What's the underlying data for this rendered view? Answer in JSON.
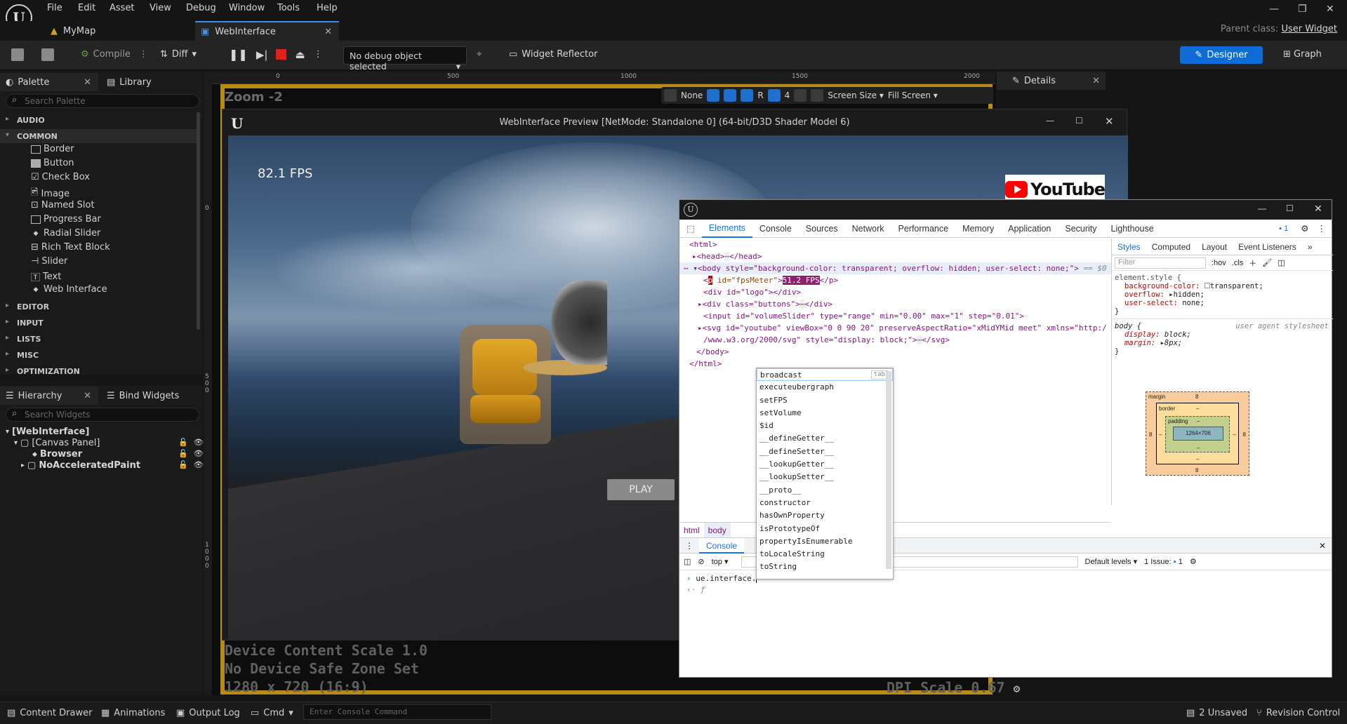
{
  "menu": {
    "items": [
      "File",
      "Edit",
      "Asset",
      "View",
      "Debug",
      "Window",
      "Tools",
      "Help"
    ]
  },
  "tabs": {
    "map": "MyMap",
    "widget": "WebInterface",
    "parent_class_label": "Parent class:",
    "parent_class_value": "User Widget"
  },
  "toolbar": {
    "compile": "Compile",
    "diff": "Diff",
    "debug_select": "No debug object selected",
    "widget_reflector": "Widget Reflector",
    "designer": "Designer",
    "graph": "Graph"
  },
  "palette": {
    "tab": "Palette",
    "library_tab": "Library",
    "search_placeholder": "Search Palette",
    "categories": [
      "AUDIO",
      "COMMON",
      "EDITOR",
      "INPUT",
      "LISTS",
      "MISC",
      "OPTIMIZATION"
    ],
    "common_items": [
      "Border",
      "Button",
      "Check Box",
      "Image",
      "Named Slot",
      "Progress Bar",
      "Radial Slider",
      "Rich Text Block",
      "Slider",
      "Text",
      "Web Interface"
    ]
  },
  "hierarchy": {
    "tab": "Hierarchy",
    "bind_tab": "Bind Widgets",
    "search_placeholder": "Search Widgets",
    "items": [
      "[WebInterface]",
      "[Canvas Panel]",
      "Browser",
      "NoAcceleratedPaint"
    ]
  },
  "canvas": {
    "zoom": "Zoom -2",
    "ruler_marks": [
      "0",
      "500",
      "1000",
      "1500",
      "2000"
    ],
    "ruler_left": [
      "0",
      "500",
      "1000"
    ],
    "none_label": "None",
    "r_label": "R",
    "grid_value": "4",
    "screen_size": "Screen Size",
    "fill_screen": "Fill Screen",
    "device_scale": "Device Content Scale 1.0",
    "safe_zone": "No Device Safe Zone Set",
    "resolution": "1280 x 720 (16:9)",
    "dpi_scale": "DPI Scale 0.67"
  },
  "preview": {
    "title": "WebInterface Preview [NetMode: Standalone 0]  (64-bit/D3D Shader Model 6)",
    "fps": "82.1 FPS",
    "youtube": "YouTube",
    "play": "PLAY"
  },
  "devtools": {
    "tabs": [
      "Elements",
      "Console",
      "Sources",
      "Network",
      "Performance",
      "Memory",
      "Application",
      "Security",
      "Lighthouse"
    ],
    "issues_count": "1",
    "styles_tabs": [
      "Styles",
      "Computed",
      "Layout",
      "Event Listeners"
    ],
    "filter_placeholder": "Filter",
    "hov": ":hov",
    "cls": ".cls",
    "dom": {
      "html_open": "<html>",
      "head": "<head>",
      "head_close": "</head>",
      "body_open": "<body style=\"background-color: transparent; overflow: hidden; user-select: none;\">",
      "body_eq": "== $0",
      "p_id": "id=\"fpsMeter\"",
      "p_text": "51.2 FPS",
      "div_logo": "<div id=\"logo\"></div>",
      "div_buttons": "<div class=\"buttons\">",
      "div_close": "</div>",
      "input_line": "<input id=\"volumeSlider\" type=\"range\" min=\"0.00\" max=\"1\" step=\"0.01\">",
      "svg_line1": "<svg id=\"youtube\" viewBox=\"0 0 90 20\" preserveAspectRatio=\"xMidYMid meet\" xmlns=\"http:/",
      "svg_line2": "/www.w3.org/2000/svg\" style=\"display: block;\">",
      "svg_close": "</svg>",
      "body_close": "</body>",
      "html_close": "</html>"
    },
    "styles": {
      "element_style": "element.style {",
      "bg": "background-color:",
      "bg_val": "transparent;",
      "overflow": "overflow:",
      "overflow_val": "hidden;",
      "user_select": "user-select:",
      "user_select_val": "none;",
      "close": "}",
      "body_sel": "body {",
      "ua": "user agent stylesheet",
      "display": "display:",
      "display_val": "block;",
      "margin": "margin:",
      "margin_val": "8px;"
    },
    "box_model": {
      "margin_label": "margin",
      "margin_val": "8",
      "border_label": "border",
      "padding_label": "padding",
      "dash": "–",
      "size": "1264×706"
    },
    "crumbs": [
      "html",
      "body"
    ],
    "console_tab": "Console",
    "context": "top",
    "levels": "Default levels",
    "issues_label": "1 Issue:",
    "input_text": "ue.interface.",
    "result_text": "ƒ",
    "autocomplete": [
      "broadcast",
      "executeubergraph",
      "setFPS",
      "setVolume",
      "$id",
      "__defineGetter__",
      "__defineSetter__",
      "__lookupGetter__",
      "__lookupSetter__",
      "__proto__",
      "constructor",
      "hasOwnProperty",
      "isPrototypeOf",
      "propertyIsEnumerable",
      "toLocaleString",
      "toString"
    ],
    "tab_hint": "tab"
  },
  "details": {
    "tab": "Details"
  },
  "statusbar": {
    "content_drawer": "Content Drawer",
    "animations": "Animations",
    "output_log": "Output Log",
    "cmd": "Cmd",
    "console_placeholder": "Enter Console Command",
    "unsaved": "2 Unsaved",
    "revision": "Revision Control"
  }
}
